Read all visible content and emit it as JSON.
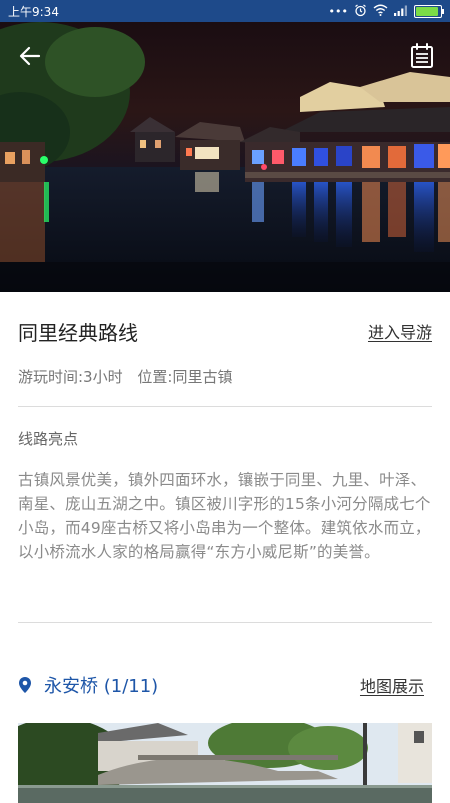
{
  "status_bar": {
    "time": "上午9:34",
    "icons": [
      "dots-icon",
      "alarm-icon",
      "wifi-icon",
      "signal-icon",
      "battery-icon"
    ],
    "battery_level": 0.9,
    "background": "#1e4a8a"
  },
  "header": {
    "back_icon": "arrow-left-icon",
    "doc_icon": "document-list-icon"
  },
  "route": {
    "title": "同里经典路线",
    "enter_guide_label": "进入导游",
    "duration_text": "游玩时间:3小时",
    "location_text": "位置:同里古镇"
  },
  "highlights": {
    "label": "线路亮点",
    "description": "古镇风景优美，镇外四面环水，镶嵌于同里、九里、叶泽、南星、庞山五湖之中。镇区被川字形的15条小河分隔成七个小岛，而49座古桥又将小岛串为一个整体。建筑依水而立，以小桥流水人家的格局赢得“东方小威尼斯”的美誉。"
  },
  "stop": {
    "icon": "location-pin-icon",
    "name": "永安桥 (1/11)",
    "map_label": "地图展示",
    "accent_color": "#1e56a8"
  }
}
